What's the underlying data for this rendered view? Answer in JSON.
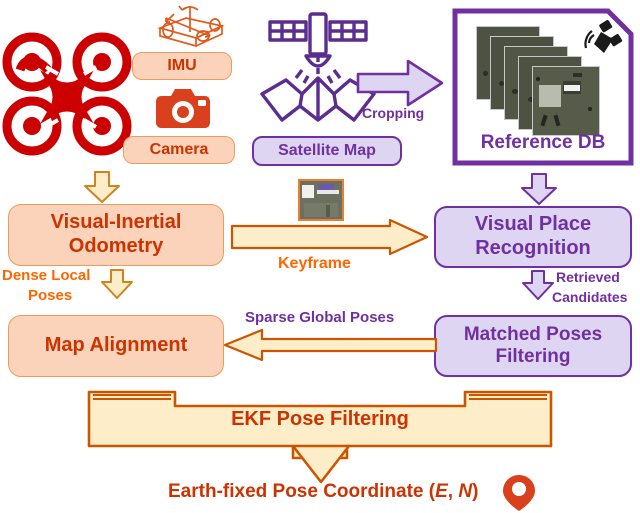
{
  "diagram": {
    "title": "UAV Visual Geo-localization Pipeline",
    "colors": {
      "orange_fill": "#fbd3ba",
      "orange_border": "#f09a5e",
      "orange_text": "#cc3300",
      "orange_label": "#ff6600",
      "purple_fill": "#ded5f2",
      "purple_border": "#7030a0",
      "purple_text": "#7030a0",
      "cream_fill": "#fdeec9",
      "cream_border": "#cc5500",
      "drone_red": "#cc0000",
      "camera_red": "#d9411e",
      "pin_red": "#d9411e"
    }
  },
  "sensors": {
    "drone_icon": "quadcopter-drone-icon",
    "imu_icon": "imu-gyroscope-box-icon",
    "imu_label": "IMU",
    "camera_icon": "camera-icon",
    "camera_label": "Camera"
  },
  "satellite": {
    "icon": "satellite-beaming-map-icon",
    "label": "Satellite Map",
    "cropping_arrow_label": "Cropping"
  },
  "reference_db": {
    "label": "Reference DB",
    "satellite_dish_icon": "satellite-dish-icon",
    "thumbnail_count": 5,
    "thumbnail_name": "aerial-reference-tile"
  },
  "blocks": {
    "vio": {
      "line1": "Visual-Inertial",
      "line2": "Odometry"
    },
    "map_alignment": {
      "line1": "Map Alignment",
      "line2": ""
    },
    "vpr": {
      "line1": "Visual Place",
      "line2": "Recognition"
    },
    "matched_poses": {
      "line1": "Matched Poses",
      "line2": "Filtering"
    },
    "ekf": {
      "line1": "EKF Pose Filtering"
    }
  },
  "edges": {
    "sensors_to_vio": "down-arrow",
    "keyframe_label": "Keyframe",
    "keyframe_thumbnail": "keyframe-aerial-thumbnail",
    "refdb_to_vpr": "down-arrow",
    "dense_local_poses_line1": "Dense Local",
    "dense_local_poses_line2": "Poses",
    "retrieved_line1": "Retrieved",
    "retrieved_line2": "Candidates",
    "sparse_global_poses": "Sparse Global Poses"
  },
  "output": {
    "text": "Earth-fixed Pose Coordinate (",
    "sym_e": "E",
    "comma": ", ",
    "sym_n": "N",
    "close": ")",
    "pin_icon": "map-pin-icon"
  }
}
